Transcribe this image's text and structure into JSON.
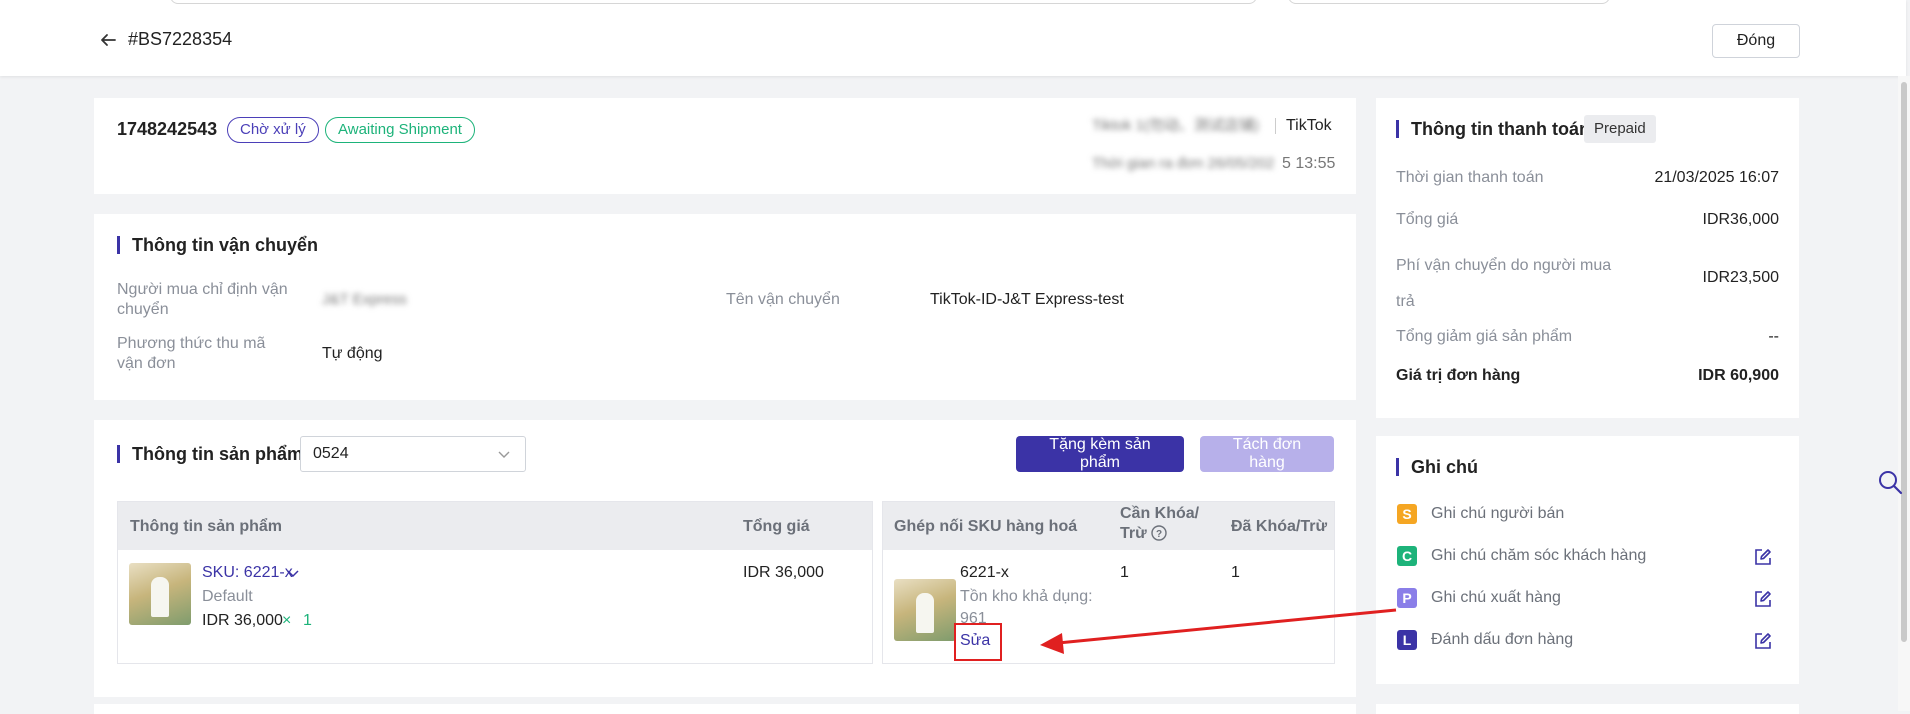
{
  "header": {
    "order_ref": "#BS7228354",
    "close_label": "Đóng"
  },
  "order": {
    "id": "1748242543",
    "status_tag": "Chờ xử lý",
    "shipping_tag": "Awaiting Shipment",
    "shop_name_blurred": "Tiktok 1(勿动、测试店铺)",
    "platform": "TikTok",
    "order_time_blurred": "Thời gian ra đơn 26/05/202",
    "order_time_visible": "5 13:55"
  },
  "shipping": {
    "title": "Thông tin vận chuyển",
    "buyer_carrier_label": "Người mua chỉ định vận chuyển",
    "buyer_carrier_value_blurred": "J&T Express",
    "carrier_name_label": "Tên vận chuyển",
    "carrier_name_value": "TikTok-ID-J&T Express-test",
    "tracking_method_label": "Phương thức thu mã vận đơn",
    "tracking_method_value": "Tự động"
  },
  "products": {
    "title": "Thông tin sản phẩm",
    "warehouse_select": "0524",
    "gift_button": "Tặng kèm sản phẩm",
    "split_button": "Tách đơn hàng",
    "left_table": {
      "headers": [
        "Thông tin sản phẩm",
        "Tổng giá"
      ],
      "row": {
        "sku": "SKU: 6221-x",
        "variant": "Default",
        "price": "IDR 36,000",
        "qty_sep": "×",
        "qty": "1",
        "total": "IDR 36,000"
      }
    },
    "right_table": {
      "headers": [
        "Ghép nối SKU hàng hoá",
        "Cần Khóa/ Trừ",
        "Đã Khóa/Trừ"
      ],
      "row": {
        "sku": "6221-x",
        "stock_label": "Tồn kho khả dụng:",
        "stock_value": "961",
        "edit_link": "Sửa",
        "to_lock": "1",
        "locked": "1"
      }
    }
  },
  "payment": {
    "title": "Thông tin thanh toán",
    "badge": "Prepaid",
    "rows": [
      {
        "label": "Thời gian thanh toán",
        "value": "21/03/2025 16:07"
      },
      {
        "label": "Tổng giá",
        "value": "IDR36,000"
      },
      {
        "label": "Phí vận chuyển do người mua trả",
        "value": "IDR23,500"
      },
      {
        "label": "Tổng giảm giá sản phẩm",
        "value": "--"
      }
    ],
    "total_label": "Giá trị đơn hàng",
    "total_value": "IDR 60,900"
  },
  "notes": {
    "title": "Ghi chú",
    "items": [
      {
        "badge": "S",
        "label": "Ghi chú người bán",
        "color": "#f5a623"
      },
      {
        "badge": "C",
        "label": "Ghi chú chăm sóc khách hàng",
        "color": "#1db37a"
      },
      {
        "badge": "P",
        "label": "Ghi chú xuất hàng",
        "color": "#8a7ee8"
      },
      {
        "badge": "L",
        "label": "Đánh dấu đơn hàng",
        "color": "#3b33a6"
      }
    ]
  },
  "colors": {
    "accent": "#3b33a6",
    "annotation": "#e02020"
  }
}
